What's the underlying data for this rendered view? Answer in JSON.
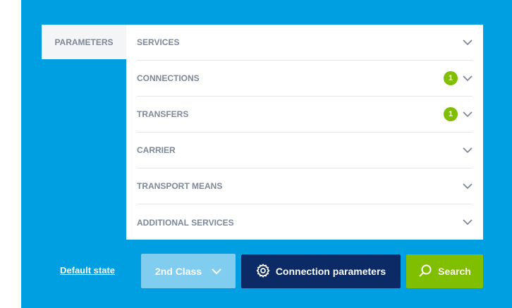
{
  "tab": {
    "label": "PARAMETERS"
  },
  "sections": [
    {
      "label": "SERVICES",
      "badge": ""
    },
    {
      "label": "CONNECTIONS",
      "badge": "1"
    },
    {
      "label": "TRANSFERS",
      "badge": "1"
    },
    {
      "label": "CARRIER",
      "badge": ""
    },
    {
      "label": "TRANSPORT MEANS",
      "badge": ""
    },
    {
      "label": "ADDITIONAL SERVICES",
      "badge": ""
    }
  ],
  "footer": {
    "default_state_link": "Default state",
    "class_select_value": "2nd Class",
    "connection_parameters_label": "Connection parameters",
    "search_label": "Search"
  },
  "colors": {
    "panel_bg": "#009fe1",
    "primary_dark": "#0b2a66",
    "accent_green": "#7fbf00",
    "select_bg": "#80cdf0"
  },
  "icons": {
    "row_toggle": "chevron-down-icon",
    "connection_parameters": "gear-icon",
    "search": "search-icon"
  }
}
